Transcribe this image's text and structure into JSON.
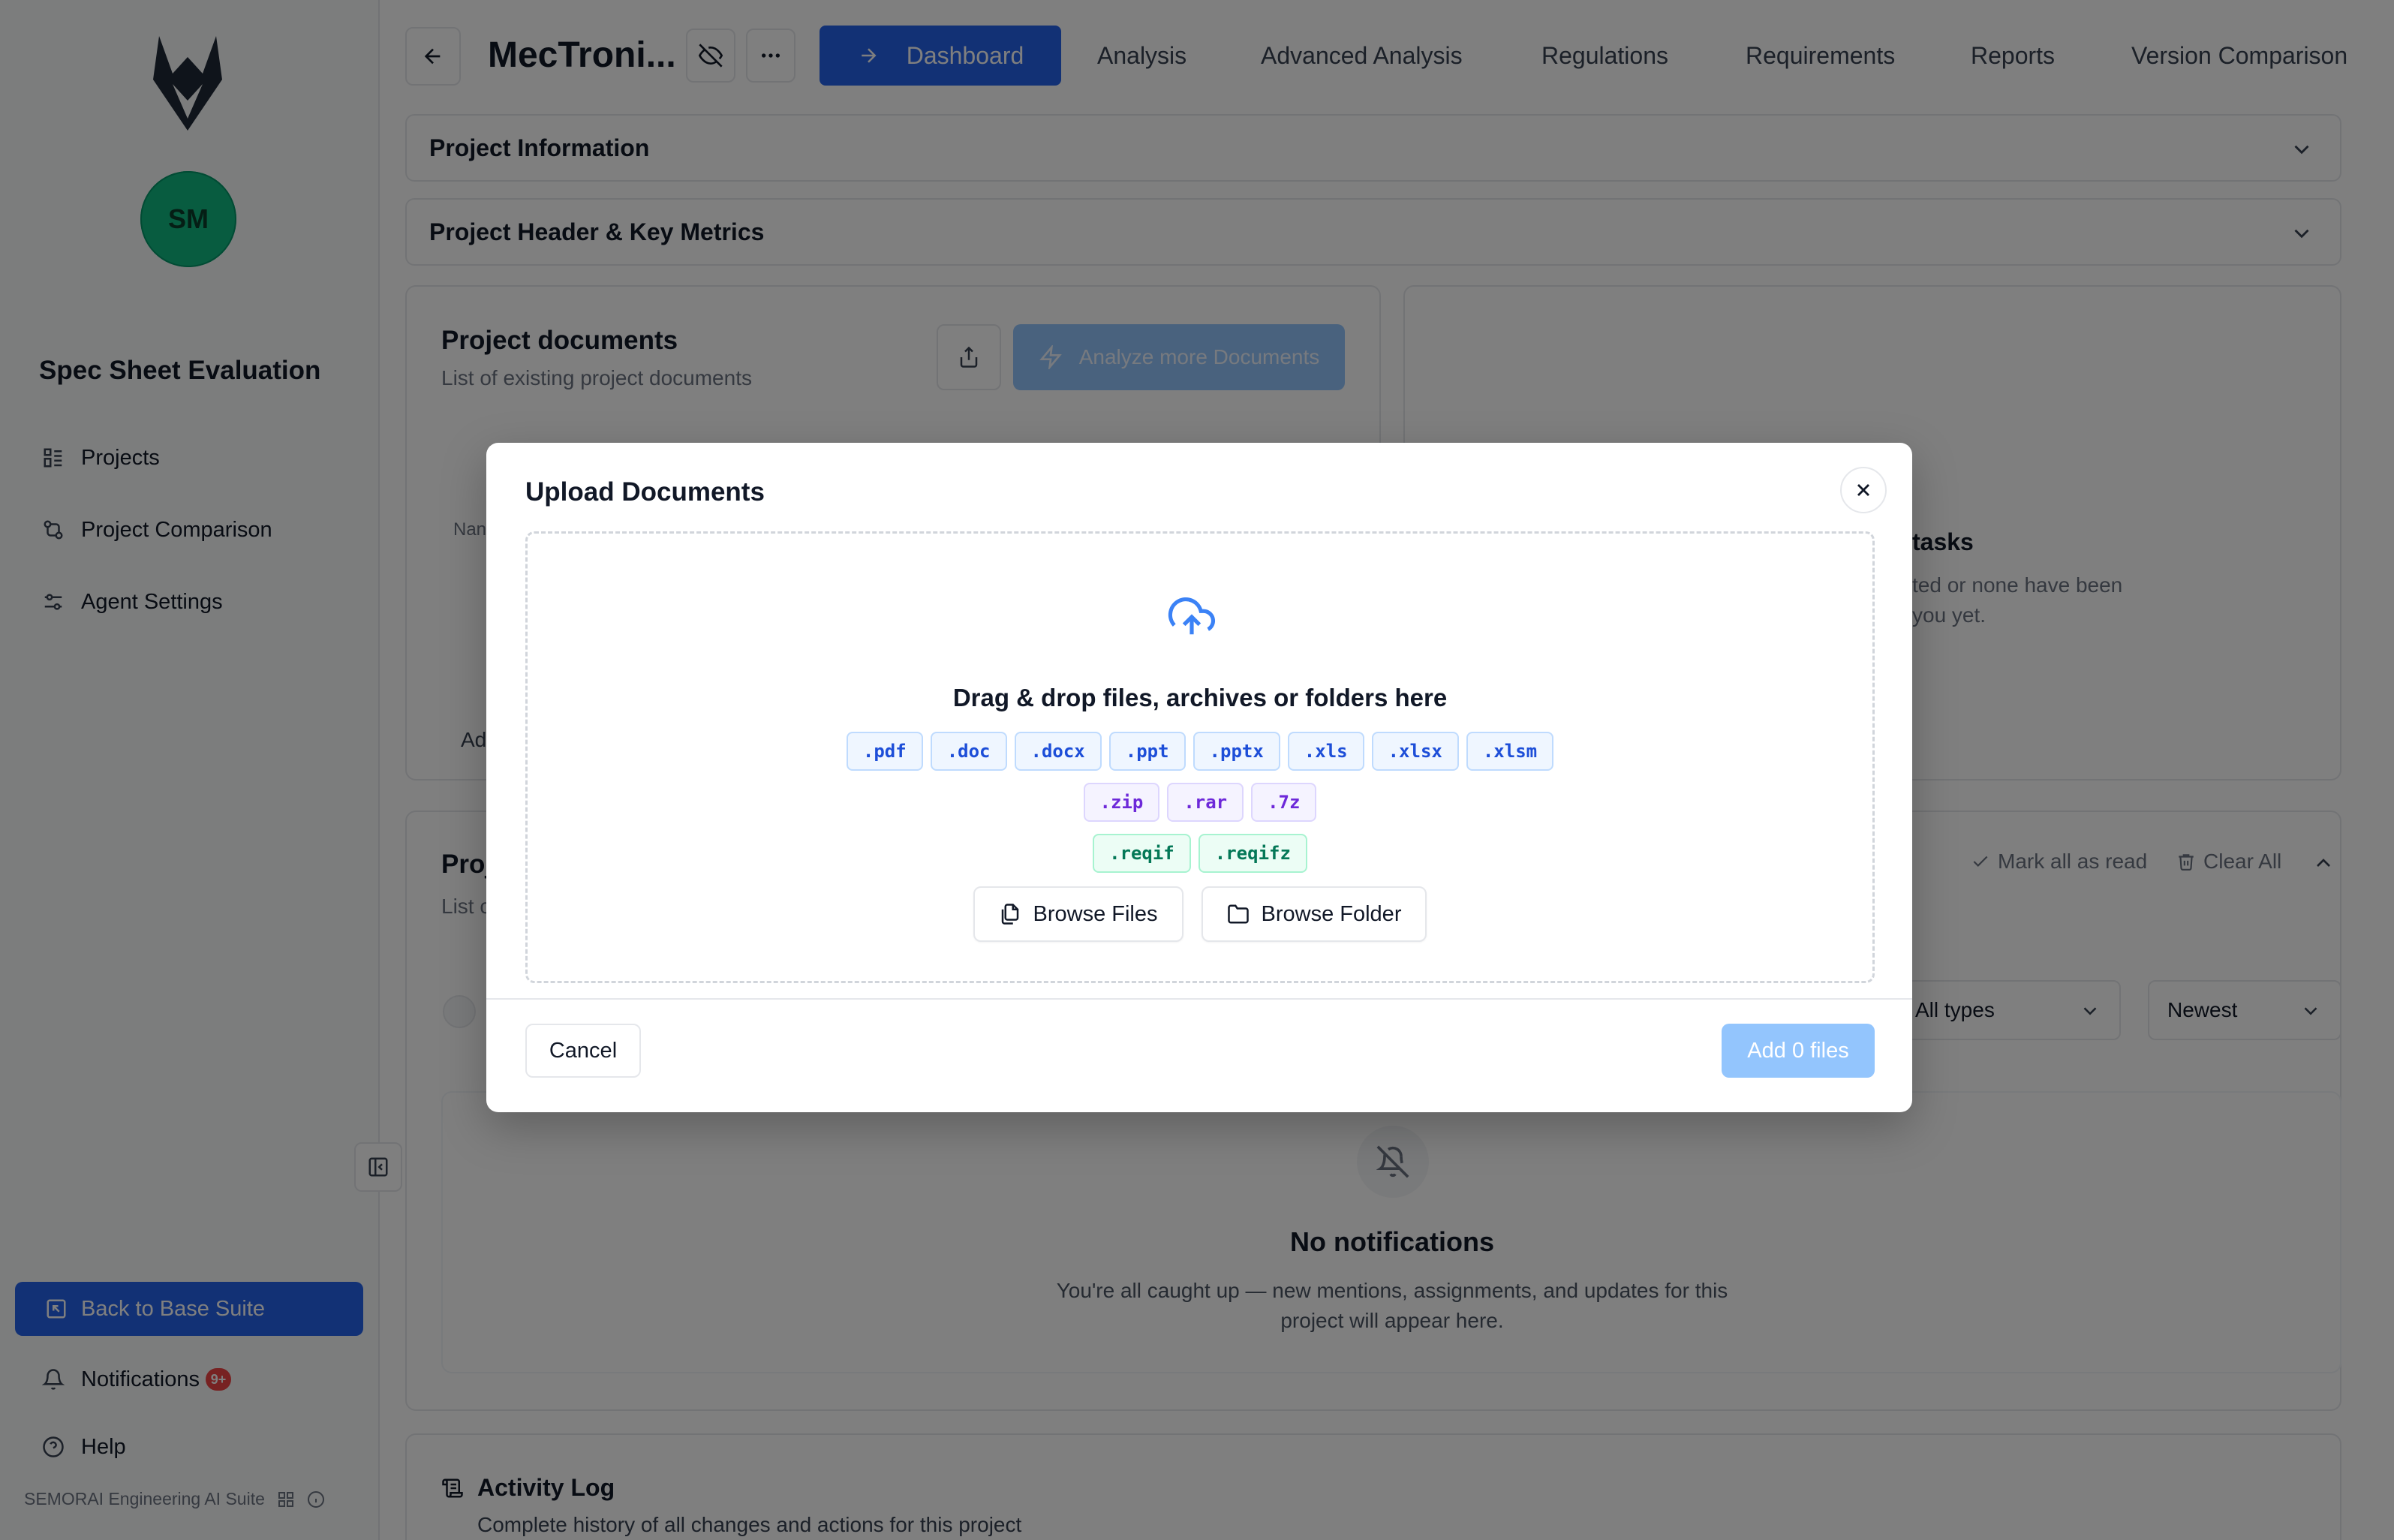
{
  "sidebar": {
    "avatar_initials": "SM",
    "app_title": "Spec Sheet Evaluation",
    "nav": [
      {
        "label": "Projects",
        "icon": "projects-list-icon"
      },
      {
        "label": "Project Comparison",
        "icon": "compare-icon"
      },
      {
        "label": "Agent Settings",
        "icon": "sliders-icon"
      }
    ],
    "back_label": "Back to Base Suite",
    "notifications_label": "Notifications",
    "notifications_badge": "9+",
    "help_label": "Help",
    "footer_label": "SEMORAI Engineering AI Suite"
  },
  "topbar": {
    "project_name": "MecTroni...",
    "tabs": [
      {
        "label": "Dashboard",
        "active": true
      },
      {
        "label": "Analysis"
      },
      {
        "label": "Advanced Analysis"
      },
      {
        "label": "Regulations"
      },
      {
        "label": "Requirements"
      },
      {
        "label": "Reports"
      },
      {
        "label": "Version Comparison"
      }
    ]
  },
  "sections": {
    "project_information": "Project Information",
    "project_header": "Project Header & Key Metrics"
  },
  "documents_card": {
    "title": "Project documents",
    "subtitle": "List of existing project documents",
    "analyze_label": "Analyze more Documents",
    "name_col_fragment": "Nan",
    "add_fragment": "Ad"
  },
  "tasks_card": {
    "title_fragment": "tasks",
    "line1_fragment": "ted or none have been",
    "line2_fragment": "you yet."
  },
  "notifications_card": {
    "title_fragment": "Proj",
    "subtitle_fragment": "List c",
    "mark_all_read": "Mark all as read",
    "clear_all": "Clear All",
    "type_filter": "All types",
    "sort_filter": "Newest",
    "empty_title": "No notifications",
    "empty_subtitle": "You're all caught up — new mentions, assignments, and updates for this project will appear here."
  },
  "activity": {
    "title": "Activity Log",
    "subtitle": "Complete history of all changes and actions for this project"
  },
  "modal": {
    "title": "Upload Documents",
    "drop_text": "Drag & drop files, archives or folders here",
    "doc_types": [
      ".pdf",
      ".doc",
      ".docx",
      ".ppt",
      ".pptx",
      ".xls",
      ".xlsx",
      ".xlsm"
    ],
    "archive_types": [
      ".zip",
      ".rar",
      ".7z"
    ],
    "reqif_types": [
      ".reqif",
      ".reqifz"
    ],
    "browse_files": "Browse Files",
    "browse_folder": "Browse Folder",
    "cancel": "Cancel",
    "add_files": "Add 0 files"
  },
  "colors": {
    "primary": "#2563eb",
    "primary_disabled": "#93c5fd",
    "avatar": "#10b981",
    "badge": "#ef4444"
  }
}
